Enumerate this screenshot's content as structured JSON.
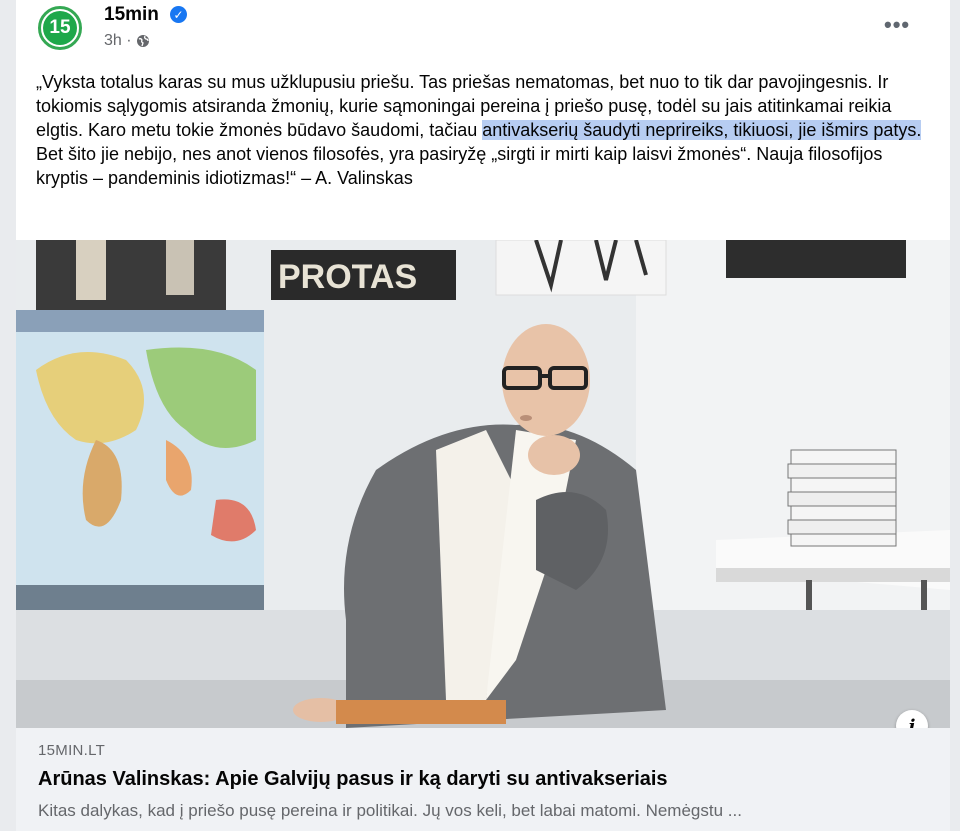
{
  "post": {
    "page_name": "15min",
    "avatar_text": "15",
    "timestamp": "3h ·",
    "verified_symbol": "✓",
    "more_symbol": "•••",
    "text_part1": "„Vyksta totalus karas su mus užklupusiu priešu. Tas priešas nematomas, bet nuo to tik dar pavojingesnis. Ir tokiomis sąlygomis atsiranda žmonių, kurie sąmoningai pereina į priešo pusę, todėl su jais atitinkamai reikia elgtis. Karo metu tokie žmonės būdavo šaudomi, tačiau ",
    "text_highlight": "antivakserių šaudyti neprireiks, tikiuosi, jie išmirs patys.",
    "text_part2": " Bet šito jie nebijo, nes anot vienos filosofės, yra pasiryžę „sirgti ir mirti kaip laisvi žmonės“. Nauja filosofijos kryptis – pandeminis idiotizmas!“ – A. Valinskas"
  },
  "image": {
    "poster_text": "PROTAS",
    "accent_colors": {
      "brand_green": "#1ea84a",
      "highlight": "#b7cdf2",
      "verified_blue": "#1877f2"
    }
  },
  "link": {
    "domain": "15MIN.LT",
    "title": "Arūnas Valinskas: Apie Galvijų pasus ir ką daryti su antivakseriais",
    "description": "Kitas dalykas, kad į priešo pusę pereina ir politikai. Jų vos keli, bet labai matomi. Nemėgstu ...",
    "info_symbol": "i"
  }
}
